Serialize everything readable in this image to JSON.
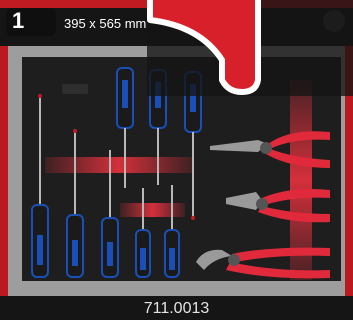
{
  "header": {
    "badge_number": "1",
    "dimensions": "395 x 565 mm"
  },
  "footer": {
    "article_number": "711.0013"
  },
  "colors": {
    "brand_red": "#c01a22",
    "foam_black": "#1e1e1e",
    "tray_grey": "#9d9d9d",
    "handle_blue": "#1a4fb8",
    "plier_red": "#e0293b",
    "glow_red": "#e8323e"
  },
  "icons": [
    "number-badge-icon",
    "brand-logo-icon",
    "check-mark-icon"
  ]
}
